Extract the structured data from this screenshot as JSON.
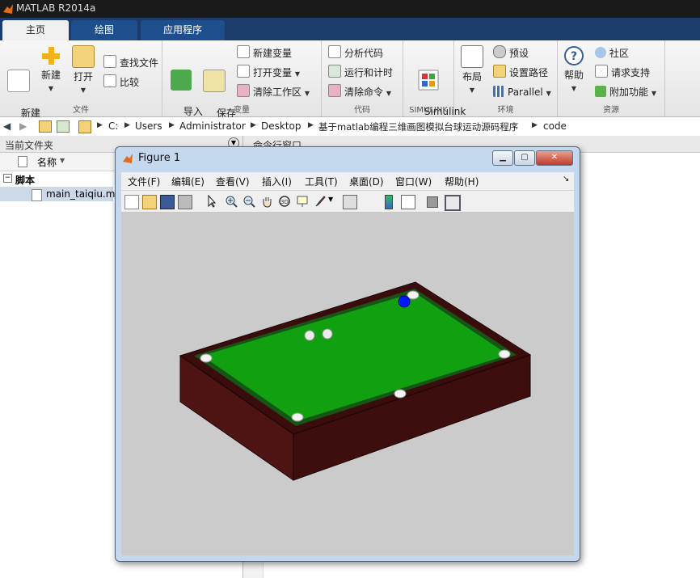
{
  "app": {
    "title": "MATLAB R2014a"
  },
  "tabs": [
    {
      "label": "主页"
    },
    {
      "label": "绘图"
    },
    {
      "label": "应用程序"
    }
  ],
  "ribbon": {
    "file": {
      "label": "文件",
      "new_script": "新建\n脚本",
      "new": "新建",
      "open": "打开",
      "find_files": "查找文件",
      "compare": "比较"
    },
    "variable": {
      "label": "变量",
      "import": "导入\n数据",
      "save_ws": "保存\n工作区",
      "new_var": "新建变量",
      "open_var": "打开变量",
      "clear_ws": "清除工作区"
    },
    "code": {
      "label": "代码",
      "analyze": "分析代码",
      "run_time": "运行和计时",
      "clear_cmd": "清除命令"
    },
    "simulink": {
      "label": "SIMULINK",
      "lib": "Simulink\n库"
    },
    "env": {
      "label": "环境",
      "layout": "布局",
      "prefs": "预设",
      "set_path": "设置路径",
      "parallel": "Parallel"
    },
    "resources": {
      "label": "资源",
      "help": "帮助",
      "community": "社区",
      "support": "请求支持",
      "addons": "附加功能"
    }
  },
  "address": {
    "crumbs": [
      "C:",
      "Users",
      "Administrator",
      "Desktop",
      "基于matlab编程三维画图模拟台球运动源码程序",
      "code"
    ]
  },
  "current_folder": {
    "title": "当前文件夹",
    "col_name": "名称",
    "group": "脚本",
    "files": [
      "main_taiqiu.m"
    ]
  },
  "command_window": {
    "title": "命令行窗口"
  },
  "figure": {
    "title": "Figure 1",
    "menus": [
      "文件(F)",
      "编辑(E)",
      "查看(V)",
      "插入(I)",
      "工具(T)",
      "桌面(D)",
      "窗口(W)",
      "帮助(H)"
    ]
  },
  "colors": {
    "felt": "#10a010",
    "rail": "#3c0e0e",
    "side": "#4a1212",
    "cue_ball": "#0018ff",
    "ribbon_tab": "#1b3c6a"
  }
}
